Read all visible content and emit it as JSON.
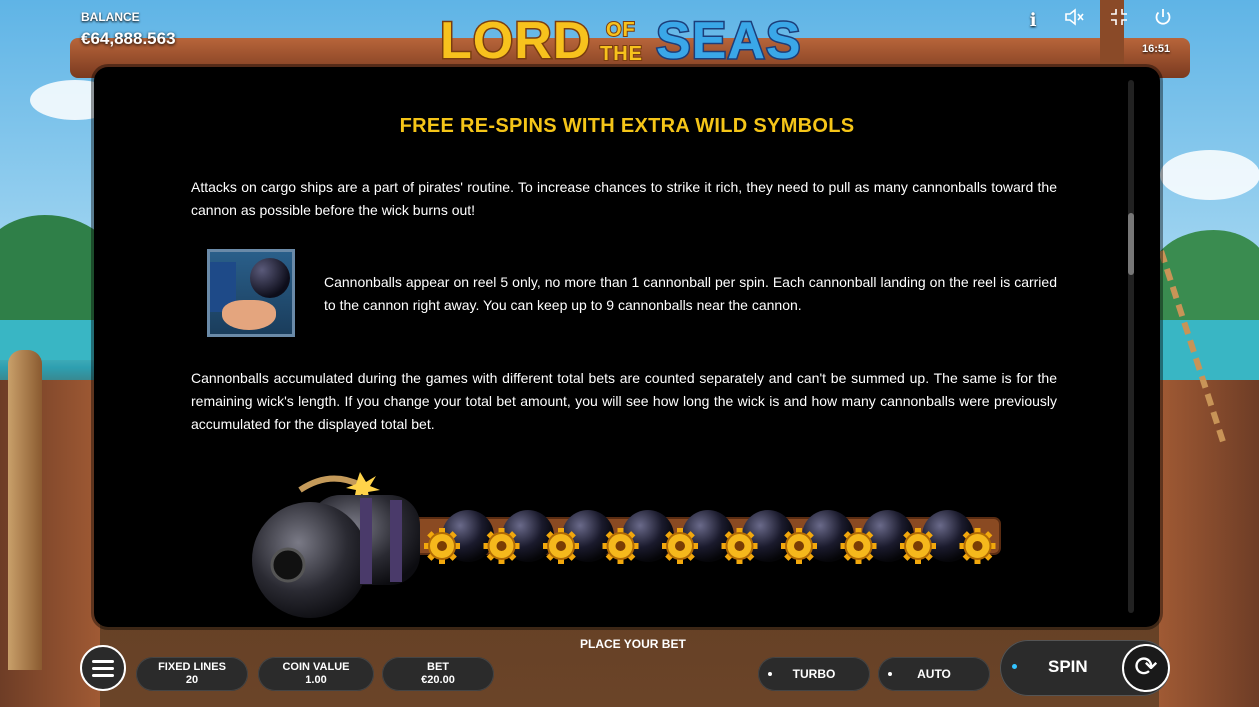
{
  "header": {
    "balance_label": "BALANCE",
    "balance_value": "€64,888.563",
    "logo": {
      "lord": "LORD",
      "of": "OF",
      "the": "THE",
      "seas": "SEAS"
    },
    "clock": "16:51",
    "icons": [
      "info-icon",
      "sound-muted-icon",
      "fullscreen-icon",
      "power-icon"
    ]
  },
  "panel": {
    "heading": "FREE RE-SPINS WITH EXTRA WILD SYMBOLS",
    "para1": "Attacks on cargo ships are a part of pirates' routine. To increase chances to strike it rich, they need to pull as many cannonballs toward the cannon as possible before the wick burns out!",
    "para2": "Cannonballs appear on reel 5 only, no more than 1 cannonball per spin. Each cannonball landing on the reel is carried to the cannon right away. You can keep up to 9 cannonballs near the cannon.",
    "para3": "Cannonballs accumulated during the games with different total bets are counted separately and can't be summed up. The same is for the remaining wick's length. If you change your total bet amount, you will see how long the wick is and how many cannonballs were previously accumulated for the displayed total bet.",
    "cannon_illustration": {
      "cannonballs": 9,
      "gears": 10
    }
  },
  "footer": {
    "place_bet": "PLACE YOUR BET",
    "fixed_lines_label": "FIXED LINES",
    "fixed_lines_value": "20",
    "coin_value_label": "COIN VALUE",
    "coin_value_value": "1.00",
    "bet_label": "BET",
    "bet_value": "€20.00",
    "turbo": "TURBO",
    "auto": "AUTO",
    "spin": "SPIN"
  },
  "colors": {
    "heading": "#f5c518",
    "panel_bg": "#000000",
    "spin_dot": "#33c3ff"
  }
}
